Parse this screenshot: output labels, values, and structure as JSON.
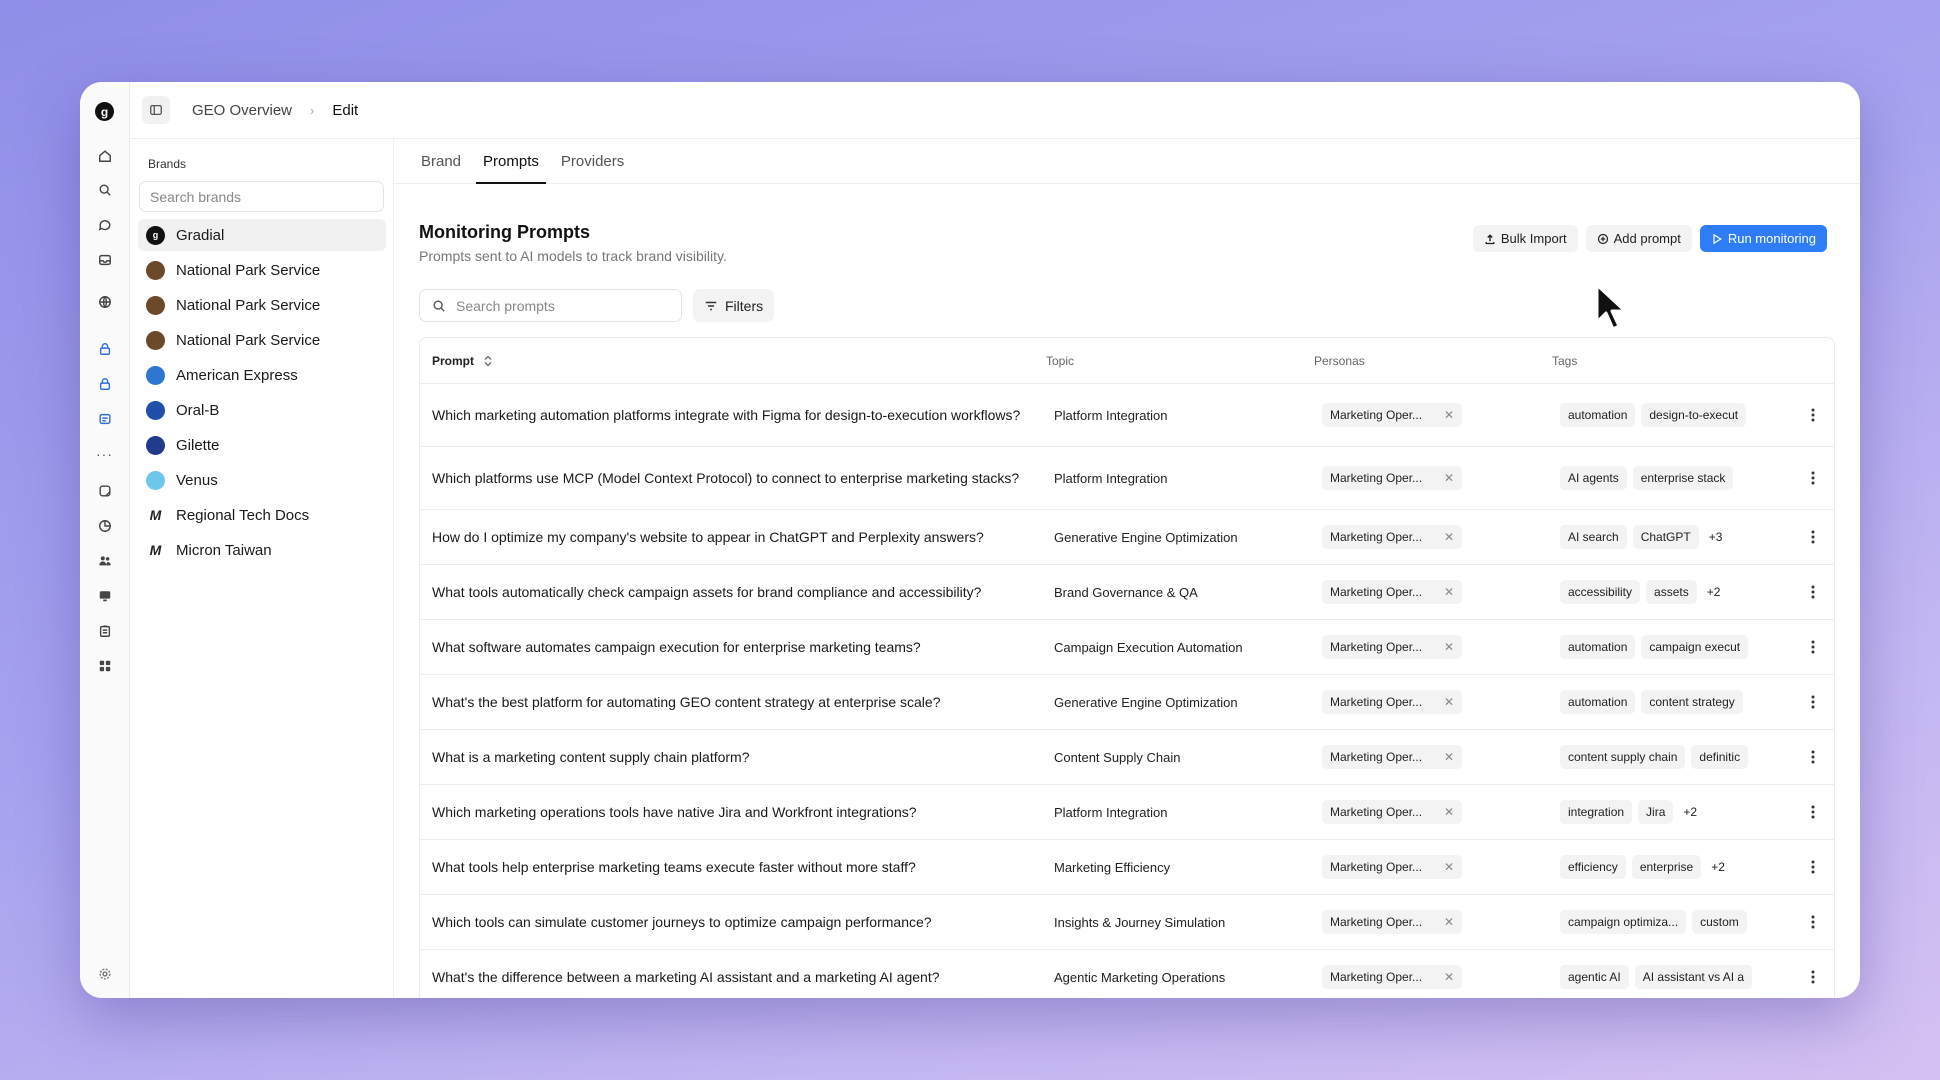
{
  "window": {
    "breadcrumb": {
      "parent": "GEO Overview",
      "separator": "›",
      "current": "Edit"
    }
  },
  "rail": {
    "logo": "g",
    "icons": [
      "home-icon",
      "search-icon",
      "chat-icon",
      "inbox-icon",
      "globe-icon",
      "lock-icon",
      "lock-icon",
      "pages-icon",
      "more-icon",
      "sticker-icon",
      "pie-chart-icon",
      "people-icon",
      "monitor-icon",
      "clipboard-icon",
      "apps-icon",
      "settings-icon"
    ]
  },
  "brands": {
    "heading": "Brands",
    "search_placeholder": "Search brands",
    "items": [
      {
        "label": "Gradial",
        "avatar": "g",
        "color": "#111111",
        "active": true
      },
      {
        "label": "National Park Service",
        "avatar": "",
        "color": "#6b4a2b",
        "active": false
      },
      {
        "label": "National Park Service",
        "avatar": "",
        "color": "#6b4a2b",
        "active": false
      },
      {
        "label": "National Park Service",
        "avatar": "",
        "color": "#6b4a2b",
        "active": false
      },
      {
        "label": "American Express",
        "avatar": "",
        "color": "#2f76d2",
        "active": false
      },
      {
        "label": "Oral-B",
        "avatar": "",
        "color": "#1f4fa8",
        "active": false
      },
      {
        "label": "Gilette",
        "avatar": "",
        "color": "#223a8c",
        "active": false
      },
      {
        "label": "Venus",
        "avatar": "",
        "color": "#6ec6ea",
        "active": false
      },
      {
        "label": "Regional Tech Docs",
        "avatar": "M",
        "color": "#ffffff",
        "active": false
      },
      {
        "label": "Micron Taiwan",
        "avatar": "M",
        "color": "#ffffff",
        "active": false
      }
    ]
  },
  "tabs": [
    {
      "label": "Brand",
      "active": false
    },
    {
      "label": "Prompts",
      "active": true
    },
    {
      "label": "Providers",
      "active": false
    }
  ],
  "page": {
    "title": "Monitoring Prompts",
    "subtitle": "Prompts sent to AI models to track brand visibility.",
    "bulk_import": "Bulk Import",
    "add_prompt": "Add prompt",
    "run_monitoring": "Run monitoring",
    "search_placeholder": "Search prompts",
    "filters": "Filters",
    "accent": "#2f7df6"
  },
  "table": {
    "headers": {
      "prompt": "Prompt",
      "topic": "Topic",
      "personas": "Personas",
      "tags": "Tags"
    },
    "rows": [
      {
        "prompt": "Which marketing automation platforms integrate with Figma for design-to-execution workflows?",
        "topic": "Platform Integration",
        "persona": "Marketing Oper...",
        "tags": [
          "automation",
          "design-to-execut"
        ]
      },
      {
        "prompt": "Which platforms use MCP (Model Context Protocol) to connect to enterprise marketing stacks?",
        "topic": "Platform Integration",
        "persona": "Marketing Oper...",
        "tags": [
          "AI agents",
          "enterprise stack"
        ]
      },
      {
        "prompt": "How do I optimize my company's website to appear in ChatGPT and Perplexity answers?",
        "topic": "Generative Engine Optimization",
        "persona": "Marketing Oper...",
        "tags": [
          "AI search",
          "ChatGPT",
          "+3"
        ]
      },
      {
        "prompt": "What tools automatically check campaign assets for brand compliance and accessibility?",
        "topic": "Brand Governance & QA",
        "persona": "Marketing Oper...",
        "tags": [
          "accessibility",
          "assets",
          "+2"
        ]
      },
      {
        "prompt": "What software automates campaign execution for enterprise marketing teams?",
        "topic": "Campaign Execution Automation",
        "persona": "Marketing Oper...",
        "tags": [
          "automation",
          "campaign execut"
        ]
      },
      {
        "prompt": "What's the best platform for automating GEO content strategy at enterprise scale?",
        "topic": "Generative Engine Optimization",
        "persona": "Marketing Oper...",
        "tags": [
          "automation",
          "content strategy"
        ]
      },
      {
        "prompt": "What is a marketing content supply chain platform?",
        "topic": "Content Supply Chain",
        "persona": "Marketing Oper...",
        "tags": [
          "content supply chain",
          "definitic"
        ]
      },
      {
        "prompt": "Which marketing operations tools have native Jira and Workfront integrations?",
        "topic": "Platform Integration",
        "persona": "Marketing Oper...",
        "tags": [
          "integration",
          "Jira",
          "+2"
        ]
      },
      {
        "prompt": "What tools help enterprise marketing teams execute faster without more staff?",
        "topic": "Marketing Efficiency",
        "persona": "Marketing Oper...",
        "tags": [
          "efficiency",
          "enterprise",
          "+2"
        ]
      },
      {
        "prompt": "Which tools can simulate customer journeys to optimize campaign performance?",
        "topic": "Insights & Journey Simulation",
        "persona": "Marketing Oper...",
        "tags": [
          "campaign optimiza...",
          "custom"
        ]
      },
      {
        "prompt": "What's the difference between a marketing AI assistant and a marketing AI agent?",
        "topic": "Agentic Marketing Operations",
        "persona": "Marketing Oper...",
        "tags": [
          "agentic AI",
          "AI assistant vs AI a"
        ]
      }
    ]
  }
}
